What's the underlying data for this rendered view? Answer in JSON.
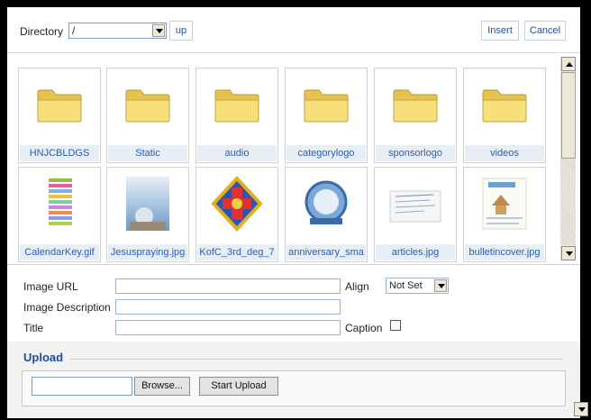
{
  "toolbar": {
    "directory_label": "Directory",
    "directory_value": "/",
    "up_label": "up",
    "insert_label": "Insert",
    "cancel_label": "Cancel"
  },
  "files": [
    {
      "name": "HNJCBLDGS",
      "kind": "folder"
    },
    {
      "name": "Static",
      "kind": "folder"
    },
    {
      "name": "audio",
      "kind": "folder"
    },
    {
      "name": "categorylogo",
      "kind": "folder"
    },
    {
      "name": "sponsorlogo",
      "kind": "folder"
    },
    {
      "name": "videos",
      "kind": "folder"
    },
    {
      "name": "CalendarKey.gif",
      "kind": "image"
    },
    {
      "name": "Jesuspraying.jpg",
      "kind": "image"
    },
    {
      "name": "KofC_3rd_deg_7",
      "kind": "image"
    },
    {
      "name": "anniversary_sma",
      "kind": "image"
    },
    {
      "name": "articles.jpg",
      "kind": "image"
    },
    {
      "name": "bulletincover.jpg",
      "kind": "image"
    }
  ],
  "properties": {
    "image_url_label": "Image URL",
    "image_description_label": "Image Description",
    "title_label": "Title",
    "align_label": "Align",
    "align_value": "Not Set",
    "caption_label": "Caption"
  },
  "upload": {
    "title": "Upload",
    "browse_label": "Browse...",
    "start_label": "Start Upload"
  },
  "colors": {
    "link_blue": "#1a4fa0",
    "folder_yellow": "#f5d86b",
    "label_bg": "#e8eef6"
  }
}
